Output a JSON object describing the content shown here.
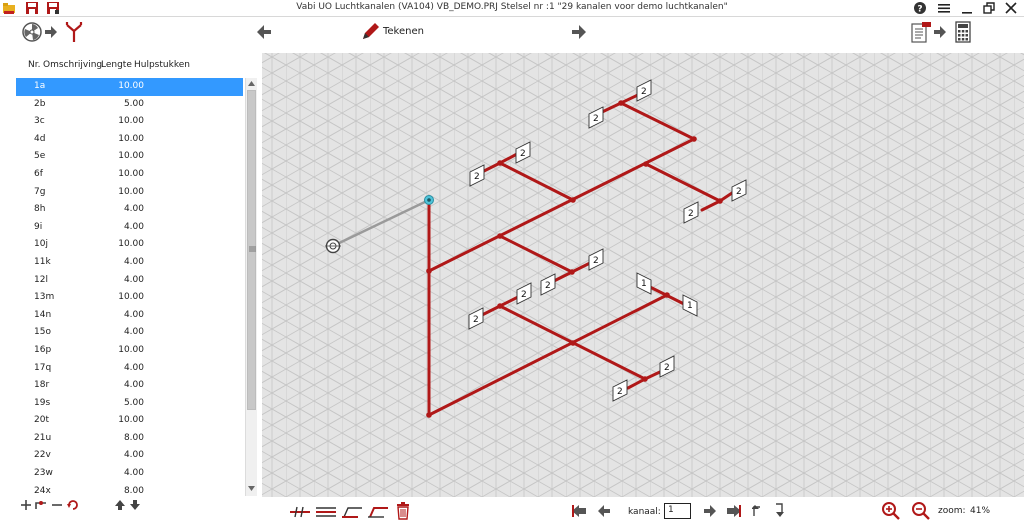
{
  "window": {
    "title": "Vabi UO Luchtkanalen (VA104)  VB_DEMO.PRJ      Stelsel nr   :1  \"29 kanalen voor demo luchtkanalen\"",
    "help": "?",
    "minimize": "_"
  },
  "toolbar": {
    "tekenen_label": "Tekenen"
  },
  "list": {
    "headers": {
      "nr": "Nr.",
      "omschrijving": "Omschrijving",
      "lengte": "Lengte",
      "hulpstukken": "Hulpstukken"
    },
    "rows": [
      {
        "nr": "1a",
        "lengte": "10.00",
        "selected": true
      },
      {
        "nr": "2b",
        "lengte": "5.00"
      },
      {
        "nr": "3c",
        "lengte": "10.00"
      },
      {
        "nr": "4d",
        "lengte": "10.00"
      },
      {
        "nr": "5e",
        "lengte": "10.00"
      },
      {
        "nr": "6f",
        "lengte": "10.00"
      },
      {
        "nr": "7g",
        "lengte": "10.00"
      },
      {
        "nr": "8h",
        "lengte": "4.00"
      },
      {
        "nr": "9i",
        "lengte": "4.00"
      },
      {
        "nr": "10j",
        "lengte": "10.00"
      },
      {
        "nr": "11k",
        "lengte": "4.00"
      },
      {
        "nr": "12l",
        "lengte": "4.00"
      },
      {
        "nr": "13m",
        "lengte": "10.00"
      },
      {
        "nr": "14n",
        "lengte": "4.00"
      },
      {
        "nr": "15o",
        "lengte": "4.00"
      },
      {
        "nr": "16p",
        "lengte": "10.00"
      },
      {
        "nr": "17q",
        "lengte": "4.00"
      },
      {
        "nr": "18r",
        "lengte": "4.00"
      },
      {
        "nr": "19s",
        "lengte": "5.00"
      },
      {
        "nr": "20t",
        "lengte": "10.00"
      },
      {
        "nr": "21u",
        "lengte": "8.00"
      },
      {
        "nr": "22v",
        "lengte": "4.00"
      },
      {
        "nr": "23w",
        "lengte": "4.00"
      },
      {
        "nr": "24x",
        "lengte": "8.00"
      }
    ]
  },
  "canvas": {
    "tags": [
      "2",
      "2",
      "2",
      "2",
      "2",
      "2",
      "2",
      "2",
      "2",
      "2",
      "2",
      "2",
      "1",
      "1",
      "2",
      "2"
    ]
  },
  "bottom": {
    "kanaal_label": "kanaal:",
    "kanaal_value": "1",
    "zoom_label": "zoom:",
    "zoom_value": "41%"
  },
  "colors": {
    "duct": "#b01818",
    "selection": "#3399ff",
    "grid_bg": "#e4e4e4",
    "grid_line": "#c6c6c6"
  }
}
